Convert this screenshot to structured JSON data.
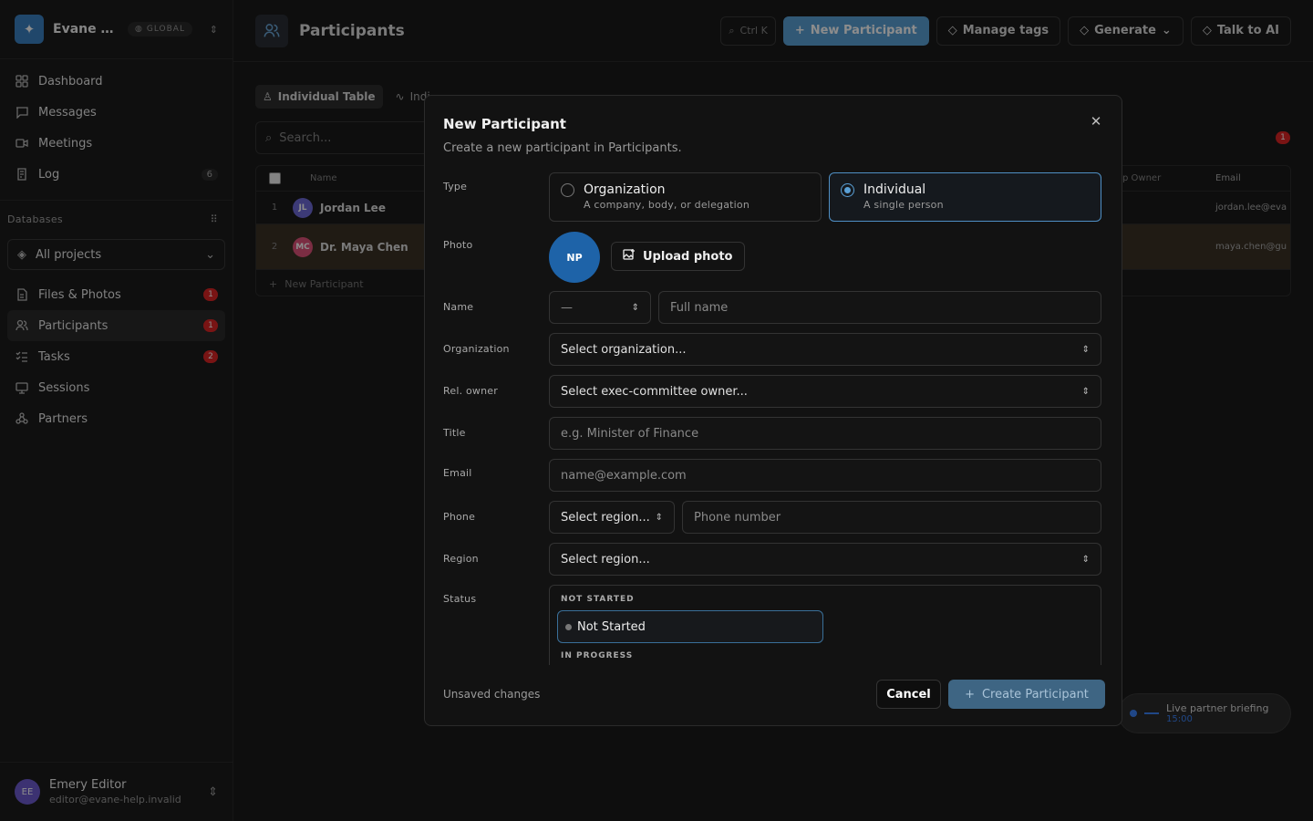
{
  "sidebar": {
    "workspace_name": "Evane He...",
    "workspace_badge": "GLOBAL",
    "nav": [
      {
        "label": "Dashboard"
      },
      {
        "label": "Messages"
      },
      {
        "label": "Meetings"
      },
      {
        "label": "Log",
        "count": "6"
      }
    ],
    "databases_label": "Databases",
    "project_select": "All projects",
    "db_items": [
      {
        "label": "Files & Photos",
        "badge": "1"
      },
      {
        "label": "Participants",
        "badge": "1"
      },
      {
        "label": "Tasks",
        "badge": "2"
      },
      {
        "label": "Sessions"
      },
      {
        "label": "Partners"
      }
    ],
    "user": {
      "initials": "EE",
      "name": "Emery Editor",
      "email": "editor@evane-help.invalid"
    }
  },
  "header": {
    "title": "Participants",
    "shortcut": "Ctrl K",
    "new_label": "New Participant",
    "tags_label": "Manage tags",
    "generate_label": "Generate",
    "ai_label": "Talk to AI"
  },
  "views": {
    "active": "Individual Table",
    "next": "Indi"
  },
  "table": {
    "search_placeholder": "Search...",
    "col_name": "Name",
    "col_owner": "p Owner",
    "col_email": "Email",
    "rows": [
      {
        "num": "1",
        "initials": "JL",
        "name": "Jordan Lee",
        "email": "jordan.lee@eva",
        "color": "#6d6ad8"
      },
      {
        "num": "2",
        "initials": "MC",
        "name": "Dr. Maya Chen",
        "email": "maya.chen@gu",
        "color": "#e0527a"
      }
    ],
    "new_row": "New Participant",
    "red_badge": "1"
  },
  "toast": {
    "title": "Live partner briefing",
    "time": "15:00"
  },
  "modal": {
    "title": "New Participant",
    "subtitle": "Create a new participant in Participants.",
    "labels": {
      "type": "Type",
      "photo": "Photo",
      "name": "Name",
      "organization": "Organization",
      "rel_owner": "Rel. owner",
      "title": "Title",
      "email": "Email",
      "phone": "Phone",
      "region": "Region",
      "status": "Status"
    },
    "type_org": {
      "title": "Organization",
      "desc": "A company, body, or delegation"
    },
    "type_ind": {
      "title": "Individual",
      "desc": "A single person"
    },
    "photo_initials": "NP",
    "upload_label": "Upload photo",
    "salutation": "—",
    "name_placeholder": "Full name",
    "org_placeholder": "Select organization...",
    "owner_placeholder": "Select exec-committee owner...",
    "title_placeholder": "e.g. Minister of Finance",
    "email_placeholder": "name@example.com",
    "phone_region_placeholder": "Select region...",
    "phone_placeholder": "Phone number",
    "region_placeholder": "Select region...",
    "status_group_1": "NOT STARTED",
    "status_option_1": "Not Started",
    "status_group_2": "IN PROGRESS",
    "unsaved": "Unsaved changes",
    "cancel_label": "Cancel",
    "create_label": "Create Participant"
  },
  "colors": {
    "accent": "#5aa0d6",
    "danger": "#dc2626",
    "avatar_np": "#1e63a8"
  }
}
